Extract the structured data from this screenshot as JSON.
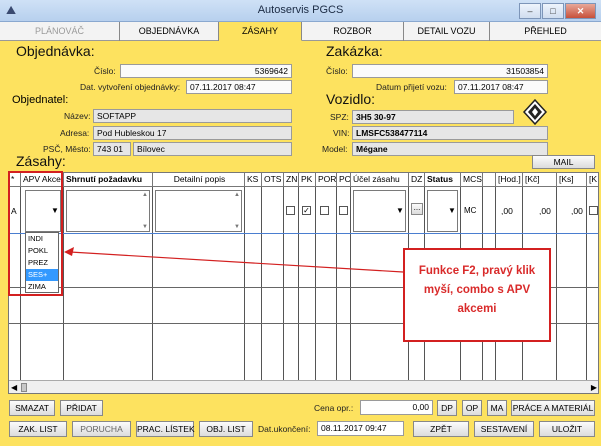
{
  "window": {
    "title": "Autoservis PGCS",
    "minimize": "–",
    "maximize": "□",
    "close": "✕",
    "app_icon": "car-icon"
  },
  "tabs": [
    {
      "label": "PLÁNOVÁČ",
      "state": "disabled"
    },
    {
      "label": "OBJEDNÁVKA",
      "state": "normal"
    },
    {
      "label": "ZÁSAHY",
      "state": "active"
    },
    {
      "label": "ROZBOR",
      "state": "normal"
    },
    {
      "label": "DETAIL VOZU",
      "state": "normal"
    },
    {
      "label": "PŘEHLED",
      "state": "normal"
    }
  ],
  "order": {
    "heading": "Objednávka:",
    "number_label": "Číslo:",
    "number": "5369642",
    "created_label": "Dat. vytvoření objednávky:",
    "created": "07.11.2017 08:47"
  },
  "job": {
    "heading": "Zakázka:",
    "number_label": "Číslo:",
    "number": "31503854",
    "accepted_label": "Datum přijetí vozu:",
    "accepted": "07.11.2017 08:47"
  },
  "customer": {
    "heading": "Objednatel:",
    "name_label": "Název:",
    "name": "SOFTAPP",
    "address_label": "Adresa:",
    "address": "Pod Hubleskou 17",
    "zip_city_label": "PSČ, Město:",
    "zip": "743 01",
    "city": "Bílovec"
  },
  "vehicle": {
    "heading": "Vozidlo:",
    "spz_label": "SPZ:",
    "spz": "3H5 30-97",
    "vin_label": "VIN:",
    "vin": "LMSFC538477114",
    "model_label": "Model:",
    "model": "Mégane",
    "brand_icon": "renault-logo-icon"
  },
  "interventions": {
    "heading": "Zásahy:",
    "mail_button": "MAIL",
    "columns": [
      "*",
      "APV Akce",
      "Shrnutí požadavku",
      "Detailní popis",
      "KS",
      "OTS",
      "ZN",
      "PK",
      "POR",
      "PC",
      "Účel zásahu",
      "DZ",
      "Status",
      "MCS",
      "",
      "[Hod.]",
      "[Kč]",
      "[Ks]",
      "[K"
    ],
    "row": {
      "marker": "A",
      "dz_button": "...",
      "mcs": "MC",
      "hod": ",00",
      "kc": ",00",
      "ks": ",00"
    },
    "dropdown_options": [
      "INDI",
      "POKL",
      "PREZ",
      "SES+",
      "ZIMA"
    ],
    "dropdown_selected": "SES+"
  },
  "annotation": {
    "text": "Funkce F2, pravý klik myší, combo s APV akcemi"
  },
  "bottom": {
    "delete_button": "SMAZAT",
    "add_button": "PŘIDAT",
    "price_label": "Cena opr.:",
    "price": "0,00",
    "dp_button": "DP",
    "op_button": "OP",
    "ma_button": "MA",
    "work_button": "PRÁCE A MATERIÁL",
    "order_list_button": "ZAK. LIST",
    "fault_button": "PORUCHA",
    "work_sheet_button": "PRAC. LÍSTEK",
    "obj_list_button": "OBJ. LIST",
    "completion_label": "Dat.ukončení:",
    "completion": "08.11.2017 09:47",
    "back_button": "ZPĚT",
    "settings_button": "SESTAVENÍ",
    "save_button": "ULOŽIT"
  },
  "colors": {
    "background": "#fde25f",
    "highlight": "#d32020",
    "selection": "#3399ff"
  }
}
